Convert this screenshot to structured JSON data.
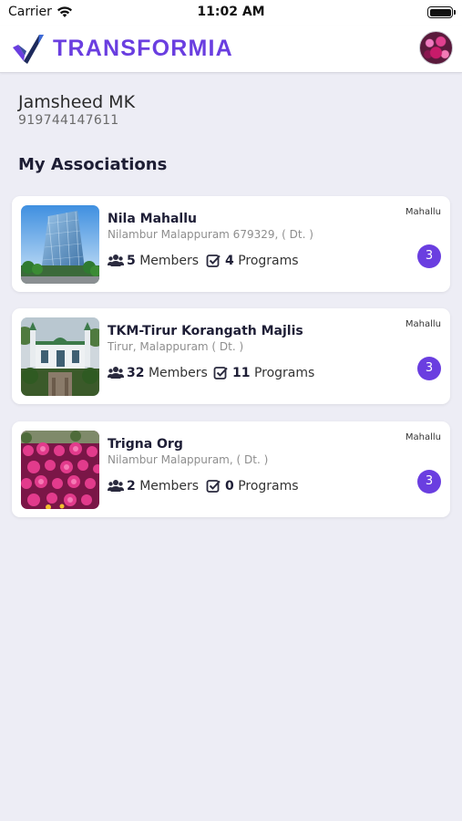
{
  "status_bar": {
    "carrier": "Carrier",
    "time": "11:02 AM"
  },
  "header": {
    "brand": "TRANSFORMIA",
    "brand_color": "#6a3ee0"
  },
  "user": {
    "name": "Jamsheed MK",
    "phone": "919744147611"
  },
  "section_title": "My Associations",
  "associations": [
    {
      "name": "Nila Mahallu",
      "address": "Nilambur Malappuram 679329, ( Dt. )",
      "type": "Mahallu",
      "members": "5",
      "members_label": "Members",
      "programs": "4",
      "programs_label": "Programs",
      "badge": "3",
      "image": "office-building-photo"
    },
    {
      "name": "TKM-Tirur Korangath Majlis",
      "address": "Tirur, Malappuram ( Dt. )",
      "type": "Mahallu",
      "members": "32",
      "members_label": "Members",
      "programs": "11",
      "programs_label": "Programs",
      "badge": "3",
      "image": "mosque-photo"
    },
    {
      "name": "Trigna Org",
      "address": "Nilambur Malappuram, ( Dt. )",
      "type": "Mahallu",
      "members": "2",
      "members_label": "Members",
      "programs": "0",
      "programs_label": "Programs",
      "badge": "3",
      "image": "pink-flowers-photo"
    }
  ],
  "icons": {
    "members": "users-icon",
    "programs": "check-square-icon",
    "wifi": "wifi-icon",
    "battery": "battery-icon"
  },
  "colors": {
    "accent": "#6a3ee0",
    "background": "#ededf5"
  }
}
